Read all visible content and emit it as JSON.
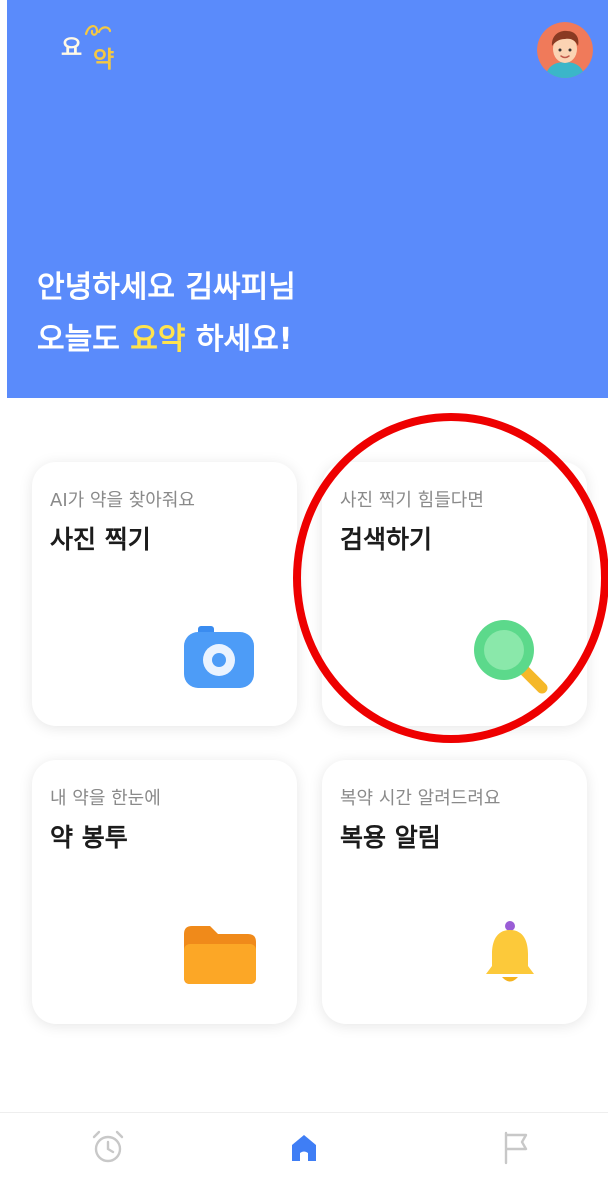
{
  "app": {
    "logo_yo": "요",
    "logo_yak": "약"
  },
  "greeting": {
    "line1": "안녕하세요 김싸피님",
    "line2_prefix": "오늘도 ",
    "line2_highlight": "요약",
    "line2_suffix": " 하세요!"
  },
  "cards": [
    {
      "subtitle": "AI가 약을 찾아줘요",
      "title": "사진 찍기",
      "icon": "camera-icon"
    },
    {
      "subtitle": "사진 찍기 힘들다면",
      "title": "검색하기",
      "icon": "magnifier-icon"
    },
    {
      "subtitle": "내 약을 한눈에",
      "title": "약 봉투",
      "icon": "folder-icon"
    },
    {
      "subtitle": "복약 시간 알려드려요",
      "title": "복용 알림",
      "icon": "bell-icon"
    }
  ],
  "nav": [
    {
      "icon": "alarm-clock-icon",
      "active": false
    },
    {
      "icon": "home-icon",
      "active": true
    },
    {
      "icon": "flag-icon",
      "active": false
    }
  ],
  "colors": {
    "header": "#5a8bfb",
    "highlight": "#ffe34d",
    "annotation": "#ee0000",
    "nav_active": "#3f7ef5",
    "nav_inactive": "#c8c8c8"
  }
}
